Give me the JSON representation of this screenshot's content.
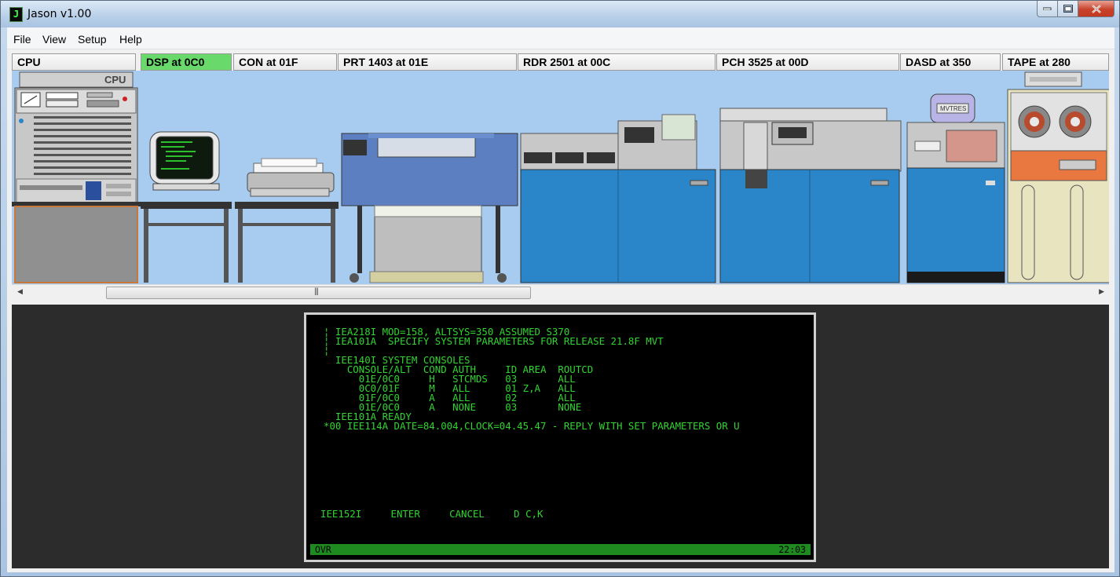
{
  "window": {
    "title": "Jason v1.00",
    "icon_glyph": "J"
  },
  "menu": [
    "File",
    "View",
    "Setup",
    "Help"
  ],
  "devices": [
    {
      "label": "CPU",
      "active": false
    },
    {
      "label": "DSP at 0C0",
      "active": true
    },
    {
      "label": "CON at 01F",
      "active": false
    },
    {
      "label": "PRT 1403 at 01E",
      "active": false
    },
    {
      "label": "RDR 2501 at 00C",
      "active": false
    },
    {
      "label": "PCH 3525 at 00D",
      "active": false
    },
    {
      "label": "DASD at 350",
      "active": false
    },
    {
      "label": "TAPE at 280",
      "active": false
    }
  ],
  "hardware": {
    "cpu_label": "CPU",
    "dasd_label": "MVTRES"
  },
  "terminal": {
    "lines": [
      "¦ IEA218I MOD=158, ALTSYS=350 ASSUMED S370",
      "¦ IEA101A  SPECIFY SYSTEM PARAMETERS FOR RELEASE 21.8F MVT",
      "¦",
      "  IEE140I SYSTEM CONSOLES",
      "    CONSOLE/ALT  COND AUTH     ID AREA  ROUTCD",
      "      01E/0C0     H   STCMDS   03       ALL",
      "      0C0/01F     M   ALL      01 Z,A   ALL",
      "      01F/0C0     A   ALL      02       ALL",
      "      01E/0C0     A   NONE     03       NONE",
      "  IEE101A READY",
      "*00 IEE114A DATE=84.004,CLOCK=04.45.47 - REPLY WITH SET PARAMETERS OR U"
    ],
    "pfkeys": "IEE152I     ENTER     CANCEL     D C,K",
    "status_left": "OVR",
    "status_right": "22:03"
  },
  "colors": {
    "terminal_text": "#31d431",
    "active_tab": "#69d96b",
    "machine_blue": "#2a86c8"
  }
}
